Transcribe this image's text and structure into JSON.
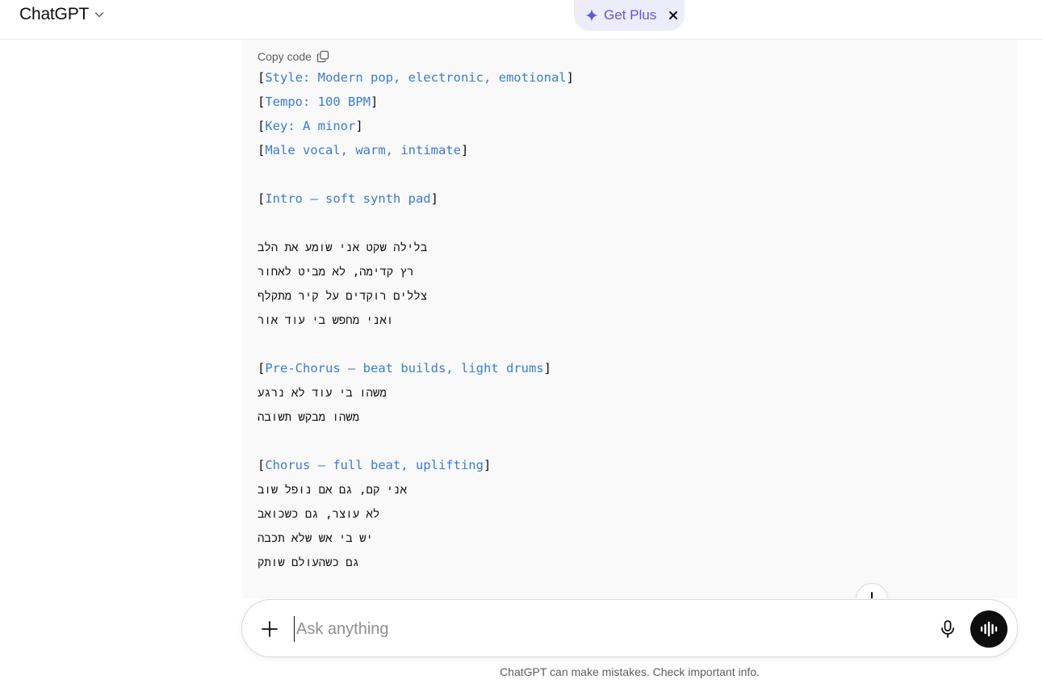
{
  "header": {
    "model_name": "ChatGPT",
    "get_plus_label": "Get Plus",
    "plus_color": "#5d5bd4"
  },
  "code_block": {
    "copy_label": "Copy code",
    "lines": [
      {
        "kind": "tag",
        "text": "Style: Modern pop, electronic, emotional"
      },
      {
        "kind": "tag",
        "text": "Tempo: 100 BPM"
      },
      {
        "kind": "tag",
        "text": "Key: A minor"
      },
      {
        "kind": "tag",
        "text": "Male vocal, warm, intimate"
      },
      {
        "kind": "blank",
        "text": ""
      },
      {
        "kind": "tag",
        "text": "Intro – soft synth pad"
      },
      {
        "kind": "blank",
        "text": ""
      },
      {
        "kind": "heb",
        "text": "בלילה שקט אני שומע את הלב"
      },
      {
        "kind": "heb",
        "text": "רץ קדימה, לא מביט לאחור"
      },
      {
        "kind": "heb",
        "text": "צללים רוקדים על קיר מתקלף"
      },
      {
        "kind": "heb",
        "text": "ואני מחפש בי עוד אור"
      },
      {
        "kind": "blank",
        "text": ""
      },
      {
        "kind": "tag",
        "text": "Pre-Chorus – beat builds, light drums"
      },
      {
        "kind": "heb",
        "text": "משהו בי עוד לא נרגע"
      },
      {
        "kind": "heb",
        "text": "משהו מבקש תשובה"
      },
      {
        "kind": "blank",
        "text": ""
      },
      {
        "kind": "tag",
        "text": "Chorus – full beat, uplifting"
      },
      {
        "kind": "heb",
        "text": "אני קם, גם אם נופל שוב"
      },
      {
        "kind": "heb",
        "text": "לא עוצר, גם כשכואב"
      },
      {
        "kind": "heb",
        "text": "יש בי אש שלא תכבה"
      },
      {
        "kind": "heb",
        "text": "גם כשהעולם שותק"
      }
    ],
    "tag_color": "#3b7bd6"
  },
  "composer": {
    "placeholder": "Ask anything"
  },
  "footer": {
    "disclaimer": "ChatGPT can make mistakes. Check important info."
  },
  "icons": {
    "model_chevron": "chevron-down-icon",
    "plus_sparkle": "sparkle-icon",
    "plus_close": "close-icon",
    "copy": "copy-icon",
    "scroll": "arrow-down-icon",
    "attach": "plus-icon",
    "mic": "microphone-icon",
    "voice": "voice-waveform-icon"
  }
}
